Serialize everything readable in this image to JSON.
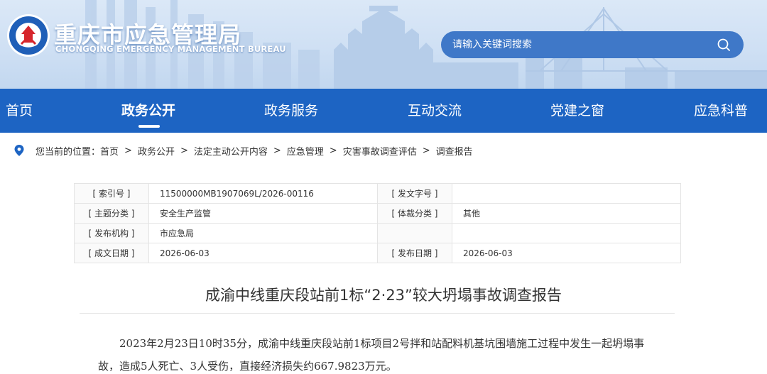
{
  "header": {
    "title": "重庆市应急管理局",
    "subtitle": "CHONGQING EMERGENCY MANAGEMENT BUREAU"
  },
  "search": {
    "placeholder": "请输入关键词搜索",
    "icon": "search-icon"
  },
  "nav": {
    "items": [
      {
        "label": "首页"
      },
      {
        "label": "政务公开"
      },
      {
        "label": "政务服务"
      },
      {
        "label": "互动交流"
      },
      {
        "label": "党建之窗"
      },
      {
        "label": "应急科普"
      }
    ],
    "active_index": 1
  },
  "breadcrumb": {
    "prefix": "您当前的位置：",
    "items": [
      "首页",
      "政务公开",
      "法定主动公开内容",
      "应急管理",
      "灾害事故调查评估",
      "调查报告"
    ],
    "separator": ">"
  },
  "info_table": {
    "rows": [
      {
        "k1": "[ 索引号 ]",
        "v1": "11500000MB1907069L/2026-00116",
        "k2": "[ 发文字号 ]",
        "v2": ""
      },
      {
        "k1": "[ 主题分类 ]",
        "v1": "安全生产监管",
        "k2": "[ 体裁分类 ]",
        "v2": "其他"
      },
      {
        "k1": "[ 发布机构 ]",
        "v1": "市应急局",
        "k2": "",
        "v2": ""
      },
      {
        "k1": "[ 成文日期 ]",
        "v1": "2026-06-03",
        "k2": "[ 发布日期 ]",
        "v2": "2026-06-03"
      }
    ]
  },
  "article": {
    "title": "成渝中线重庆段站前1标“2·23”较大坍塌事故调查报告",
    "paragraph_line1": "2023年2月23日10时35分，成渝中线重庆段站前1标项目2号拌和站配料机基坑围墙施工过程中发生一起坍塌事",
    "paragraph_line2": "故，造成5人死亡、3人受伤，直接经济损失约667.9823万元。"
  },
  "colors": {
    "nav_bg": "#1d64c3",
    "search_bg": "#3f78c8",
    "banner_bg": "#cfe0f4"
  }
}
